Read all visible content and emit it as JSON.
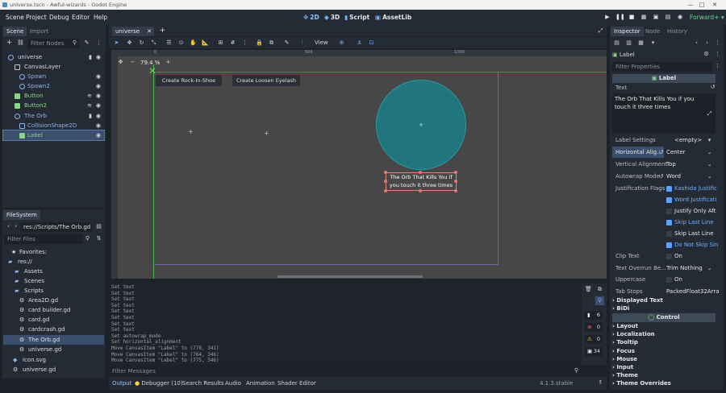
{
  "window": {
    "title": "universe.tscn - Awful-wizards - Godot Engine",
    "minimize": "—",
    "maximize": "□",
    "close": "✕"
  },
  "menus": [
    "Scene",
    "Project",
    "Debug",
    "Editor",
    "Help"
  ],
  "workspaces": [
    {
      "glyph": "✥",
      "label": "2D"
    },
    {
      "glyph": "◆",
      "label": "3D"
    },
    {
      "glyph": "▮",
      "label": "Script"
    },
    {
      "glyph": "▣",
      "label": "AssetLib"
    }
  ],
  "renderer": "Forward+",
  "scene_panel": {
    "tabs": [
      "Scene",
      "Import"
    ],
    "filter_placeholder": "Filter Nodes",
    "nodes": [
      {
        "label": "universe",
        "color": "#d6d9de"
      },
      {
        "label": "CanvasLayer",
        "color": "#d6d9de"
      },
      {
        "label": "Spawn",
        "color": "#8fb4e8"
      },
      {
        "label": "Spawn2",
        "color": "#8fb4e8"
      },
      {
        "label": "Button",
        "color": "#8ad48a"
      },
      {
        "label": "Button2",
        "color": "#8ad48a"
      },
      {
        "label": "The Orb",
        "color": "#8fb4e8"
      },
      {
        "label": "CollisionShape2D",
        "color": "#8fb4e8"
      },
      {
        "label": "Label",
        "color": "#8ad48a"
      }
    ]
  },
  "filesystem": {
    "title": "FileSystem",
    "path": "res://Scripts/The Orb.gd",
    "filter_placeholder": "Filter Files",
    "items": [
      "Favorites:",
      "res://",
      "Assets",
      "Scenes",
      "Scripts",
      "Area2D.gd",
      "card builder.gd",
      "card.gd",
      "cardcrash.gd",
      "The Orb.gd",
      "universe.gd",
      "icon.svg",
      "universe.gd"
    ]
  },
  "editor": {
    "tab": "universe",
    "view_label": "View",
    "zoom": "79.4 %",
    "zoom_out": "−",
    "zoom_in": "+",
    "ruler_ticks": [
      "0",
      "500",
      "1000"
    ],
    "buttons": [
      "Create Rock-In-Shoe",
      "Create Loosen Eyelash"
    ],
    "label_text": "The Orb That Kills You if you touch it three times",
    "orb_color": "#21767e"
  },
  "output": {
    "lines": [
      "Set text",
      "Set text",
      "Set text",
      "Set text",
      "Set text",
      "Set text",
      "Set text",
      "Set text",
      "Set autowrap_mode",
      "Set horizontal_alignment",
      "Move CanvasItem \"Label\" to (778, 341)",
      "Move CanvasItem \"Label\" to (764, 346)",
      "Move CanvasItem \"Label\" to (775, 346)"
    ],
    "filter_placeholder": "Filter Messages",
    "counts": [
      "6",
      "0",
      "0",
      "34"
    ]
  },
  "bottom_tabs": [
    "Output",
    "Debugger (10)",
    "Search Results",
    "Audio",
    "Animation",
    "Shader Editor"
  ],
  "version": "4.1.3.stable",
  "inspector": {
    "tabs": [
      "Inspector",
      "Node",
      "History"
    ],
    "node": "Label",
    "filter_placeholder": "Filter Properties",
    "class_header": "Label",
    "text_label": "Text",
    "text_value": "The Orb That Kills You if you touch it three times",
    "props": [
      {
        "label": "Label Settings",
        "value": "<empty>"
      },
      {
        "label": "Horizontal Alig...",
        "value": "Center"
      },
      {
        "label": "Vertical Alignment",
        "value": "Top"
      },
      {
        "label": "Autowrap Mode",
        "value": "Word"
      },
      {
        "label": "Justification Flags",
        "value": "Kashida Justific"
      }
    ],
    "flags": [
      {
        "label": "Kashida Justific",
        "on": true
      },
      {
        "label": "Word Justificati",
        "on": true
      },
      {
        "label": "Justify Only Aft",
        "on": false
      },
      {
        "label": "Skip Last Line",
        "on": true
      },
      {
        "label": "Skip Last Line",
        "on": false
      },
      {
        "label": "Do Not Skip Sin",
        "on": true
      }
    ],
    "props2": [
      {
        "label": "Clip Text",
        "value": "On"
      },
      {
        "label": "Text Overrun Be...",
        "value": "Trim Nothing"
      },
      {
        "label": "Uppercase",
        "value": "On"
      },
      {
        "label": "Tab Stops",
        "value": "PackedFloat32Arra"
      }
    ],
    "groups1": [
      "Displayed Text",
      "BiDi"
    ],
    "control_header": "Control",
    "groups2": [
      "Layout",
      "Localization",
      "Tooltip",
      "Focus",
      "Mouse",
      "Input",
      "Theme",
      "Theme Overrides"
    ]
  }
}
